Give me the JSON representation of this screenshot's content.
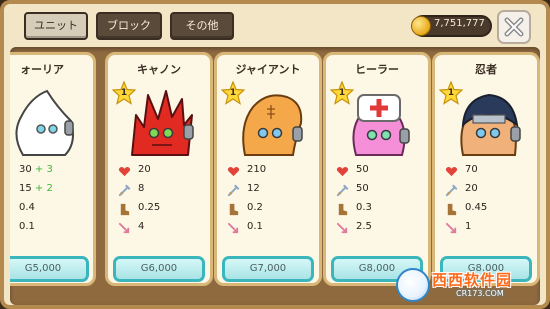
{
  "tabs": {
    "unit": "ユニット",
    "block": "ブロック",
    "other": "その他"
  },
  "currency": {
    "amount": "7,751,777"
  },
  "cards": [
    {
      "name": "ォーリア",
      "stats": [
        {
          "value": "30",
          "bonus": "+ 3"
        },
        {
          "value": "15",
          "bonus": "+ 2"
        },
        {
          "value": "0.4",
          "bonus": ""
        },
        {
          "value": "0.1",
          "bonus": ""
        }
      ],
      "price": "G5,000"
    },
    {
      "name": "キャノン",
      "level": "1",
      "stats": [
        {
          "value": "20"
        },
        {
          "value": "8"
        },
        {
          "value": "0.25"
        },
        {
          "value": "4"
        }
      ],
      "price": "G6,000"
    },
    {
      "name": "ジャイアント",
      "level": "1",
      "stats": [
        {
          "value": "210"
        },
        {
          "value": "12"
        },
        {
          "value": "0.2"
        },
        {
          "value": "0.1"
        }
      ],
      "price": "G7,000"
    },
    {
      "name": "ヒーラー",
      "level": "1",
      "stats": [
        {
          "value": "50"
        },
        {
          "value": "50"
        },
        {
          "value": "0.3"
        },
        {
          "value": "2.5"
        }
      ],
      "price": "G8,000"
    },
    {
      "name": "忍者",
      "level": "1",
      "stats": [
        {
          "value": "70"
        },
        {
          "value": "20"
        },
        {
          "value": "0.45"
        },
        {
          "value": "1"
        }
      ],
      "price": "G8,000"
    }
  ],
  "watermark": {
    "title": "西西软件园",
    "url": "CR173.COM"
  },
  "colors": {
    "accent_teal": "#3bb6bd",
    "card_border": "#d9b778",
    "bonus_green": "#3fb63a"
  }
}
